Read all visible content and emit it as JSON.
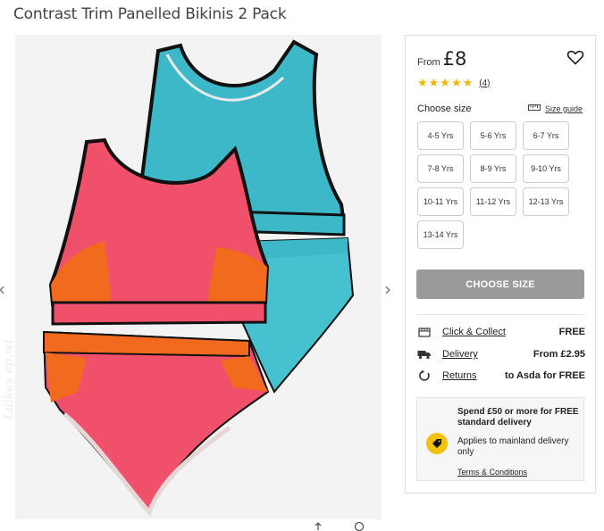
{
  "product": {
    "title": "Contrast Trim Panelled Bikinis 2 Pack",
    "from_label": "From",
    "price": "£8",
    "rating_stars": 5,
    "rating_count": "(4)"
  },
  "size_selector": {
    "label": "Choose size",
    "guide_label": "Size guide",
    "sizes": [
      "4-5 Yrs",
      "5-6 Yrs",
      "6-7 Yrs",
      "7-8 Yrs",
      "8-9 Yrs",
      "9-10 Yrs",
      "10-11 Yrs",
      "11-12 Yrs",
      "12-13 Yrs",
      "13-14 Yrs"
    ]
  },
  "cta": {
    "label": "CHOOSE SIZE"
  },
  "delivery": {
    "rows": [
      {
        "icon": "store-icon",
        "label": "Click & Collect",
        "value": "FREE"
      },
      {
        "icon": "truck-icon",
        "label": "Delivery",
        "value": "From £2.95"
      },
      {
        "icon": "return-icon",
        "label": "Returns",
        "value": "to Asda for FREE"
      }
    ]
  },
  "promo": {
    "headline": "Spend £50 or more for FREE standard delivery",
    "body": "Applies to mainland delivery only",
    "link": "Terms & Conditions"
  },
  "gallery": {
    "watermark": "Luikes ep.wt",
    "nav_prev": "‹",
    "nav_next": "›"
  },
  "colors": {
    "star": "#f2b705",
    "teal": "#3cb8c8",
    "coral": "#f0506a",
    "orange": "#f26a1e",
    "button_disabled": "#9a9a9a",
    "promo_badge": "#f4c20d"
  }
}
